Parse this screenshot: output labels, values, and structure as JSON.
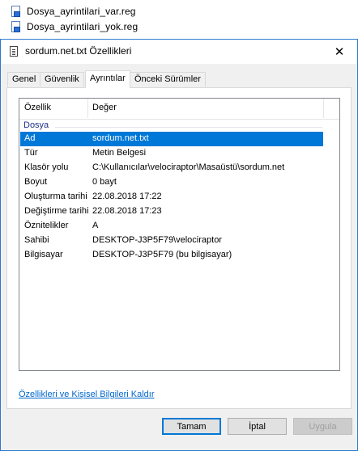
{
  "desktop_files": [
    {
      "name": "Dosya_ayrintilari_var.reg",
      "icon": "reg-file-icon"
    },
    {
      "name": "Dosya_ayrintilari_yok.reg",
      "icon": "reg-file-icon"
    }
  ],
  "window": {
    "title": "sordum.net.txt Özellikleri",
    "close_glyph": "✕"
  },
  "tabs": [
    {
      "label": "Genel"
    },
    {
      "label": "Güvenlik"
    },
    {
      "label": "Ayrıntılar",
      "active": true
    },
    {
      "label": "Önceki Sürümler"
    }
  ],
  "details": {
    "columns": {
      "property": "Özellik",
      "value": "Değer"
    },
    "group": "Dosya",
    "rows": [
      {
        "property": "Ad",
        "value": "sordum.net.txt",
        "selected": true
      },
      {
        "property": "Tür",
        "value": "Metin Belgesi"
      },
      {
        "property": "Klasör yolu",
        "value": "C:\\Kullanıcılar\\velociraptor\\Masaüstü\\sordum.net"
      },
      {
        "property": "Boyut",
        "value": "0 bayt"
      },
      {
        "property": "Oluşturma tarihi",
        "value": "22.08.2018 17:22"
      },
      {
        "property": "Değiştirme tarihi",
        "value": "22.08.2018 17:23"
      },
      {
        "property": "Öznitelikler",
        "value": "A"
      },
      {
        "property": "Sahibi",
        "value": "DESKTOP-J3P5F79\\velociraptor"
      },
      {
        "property": "Bilgisayar",
        "value": "DESKTOP-J3P5F79 (bu bilgisayar)"
      }
    ]
  },
  "remove_link": "Özellikleri ve Kişisel Bilgileri Kaldır",
  "buttons": {
    "ok": "Tamam",
    "cancel": "İptal",
    "apply": "Uygula"
  },
  "colors": {
    "selection": "#0078d7",
    "link": "#0066cc",
    "group": "#1e3287",
    "window_border": "#2b78d0"
  }
}
